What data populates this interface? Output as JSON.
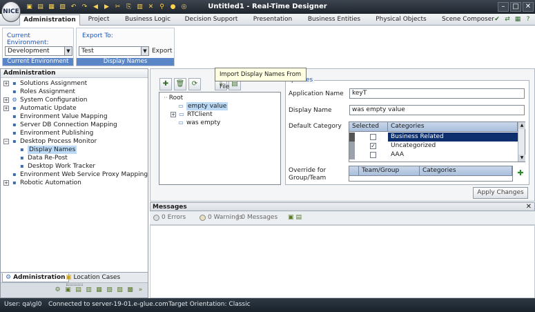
{
  "app": {
    "logo_text": "NICE",
    "title": "Untitled1 - Real-Time Designer"
  },
  "ribbon_tabs": [
    {
      "label": "Administration"
    },
    {
      "label": "Project"
    },
    {
      "label": "Business Logic"
    },
    {
      "label": "Decision Support"
    },
    {
      "label": "Presentation"
    },
    {
      "label": "Business Entities"
    },
    {
      "label": "Physical Objects"
    },
    {
      "label": "Scene Composer"
    }
  ],
  "ribbon": {
    "current_env_label": "Current Environment:",
    "current_env_value": "Development",
    "current_env_group": "Current Environment",
    "export_to_label": "Export To:",
    "export_to_value": "Test",
    "export_button": "Export",
    "display_names_group": "Display Names"
  },
  "left_panel": {
    "header": "Administration",
    "items": [
      {
        "label": "Solutions Assignment"
      },
      {
        "label": "Roles Assignment"
      },
      {
        "label": "System Configuration"
      },
      {
        "label": "Automatic Update"
      },
      {
        "label": "Environment Value Mapping"
      },
      {
        "label": "Server DB Connection Mapping"
      },
      {
        "label": "Environment Publishing"
      },
      {
        "label": "Desktop Process Monitor"
      },
      {
        "label": "Display Names"
      },
      {
        "label": "Data Re-Post"
      },
      {
        "label": "Desktop Work Tracker"
      },
      {
        "label": "Environment Web Service Proxy Mapping"
      },
      {
        "label": "Robotic Automation"
      }
    ],
    "bottom_tabs": [
      {
        "label": "Administration"
      },
      {
        "label": "Location Cases"
      }
    ]
  },
  "editor": {
    "tooltip": "Import Display Names From File",
    "tree": {
      "root": "Root",
      "children": [
        {
          "label": "empty value"
        },
        {
          "label": "RTClient"
        },
        {
          "label": "was empty"
        }
      ]
    },
    "properties": {
      "title": "perties",
      "app_name_label": "Application Name",
      "app_name_value": "keyT",
      "display_name_label": "Display Name",
      "display_name_value": "was empty value",
      "default_category_label": "Default Category",
      "category_columns": [
        "Selected",
        "Categories"
      ],
      "categories": [
        {
          "name": "Business Related",
          "checked": false
        },
        {
          "name": "Uncategorized",
          "checked": true
        },
        {
          "name": "AAA",
          "checked": false
        }
      ],
      "override_label_1": "Override for",
      "override_label_2": "Group/Team",
      "override_columns": [
        "Team/Group",
        "Categories"
      ]
    },
    "apply_button": "Apply Changes"
  },
  "messages": {
    "header": "Messages",
    "errors": "0 Errors",
    "warnings": "0 Warnings",
    "messages": "0 Messages"
  },
  "status": {
    "user": "User: qa\\gl0",
    "connection": "Connected to server-19-01.e-glue.com",
    "orientation": "Target Orientation: Classic"
  }
}
